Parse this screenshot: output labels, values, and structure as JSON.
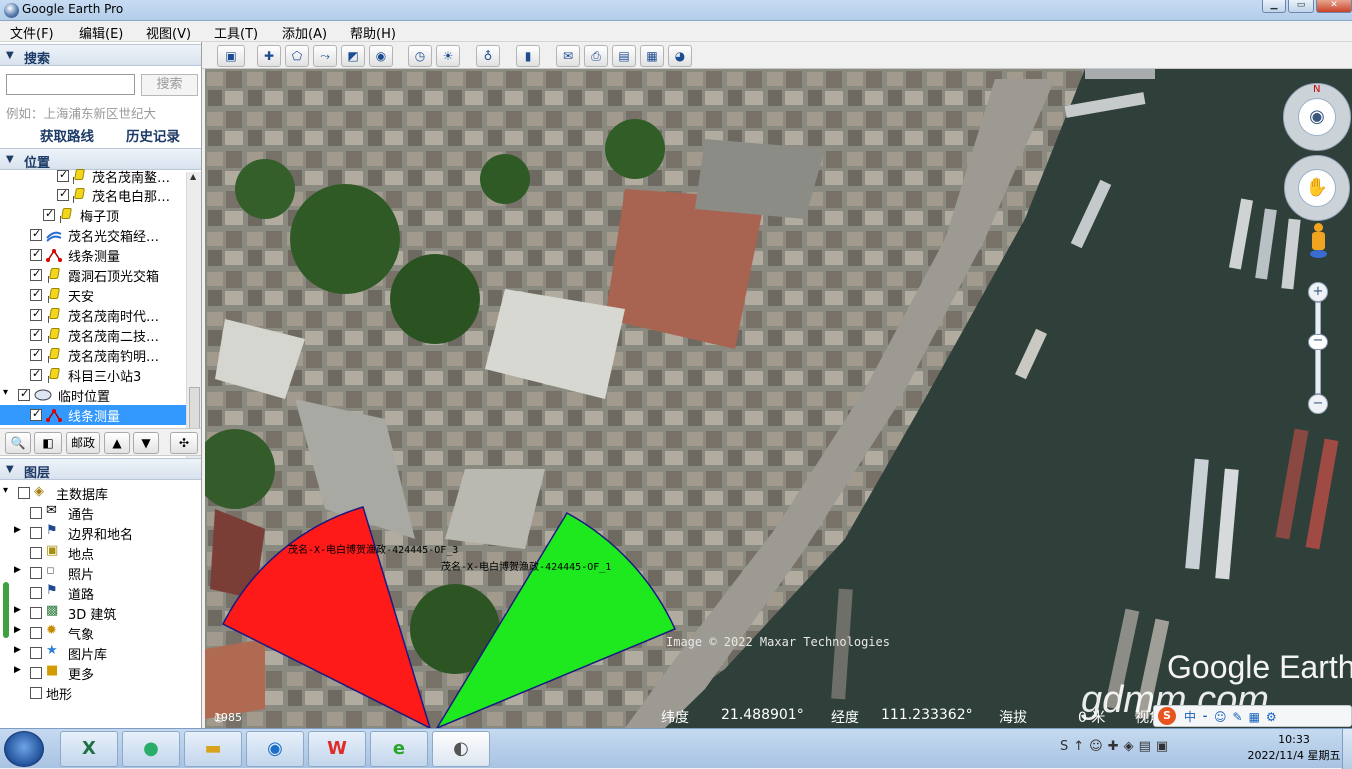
{
  "window": {
    "title": "Google Earth Pro"
  },
  "menu": [
    "文件(F)",
    "编辑(E)",
    "视图(V)",
    "工具(T)",
    "添加(A)",
    "帮助(H)"
  ],
  "search": {
    "header": "搜索",
    "button": "搜索",
    "hint": "例如：上海浦东新区世纪大",
    "get_route": "获取路线",
    "history": "历史记录"
  },
  "places": {
    "header": "位置",
    "items": [
      {
        "label": "茂名茂南鳌…",
        "checked": true,
        "icon": "placemark-icon"
      },
      {
        "label": "茂名电白那…",
        "checked": true,
        "icon": "placemark-icon"
      },
      {
        "label": "梅子顶",
        "checked": true,
        "icon": "placemark-icon"
      },
      {
        "label": "茂名光交箱经…",
        "checked": true,
        "icon": "path-icon"
      },
      {
        "label": "线条测量",
        "checked": true,
        "icon": "measure-icon"
      },
      {
        "label": "霞洞石顶光交箱",
        "checked": true,
        "icon": "placemark-icon"
      },
      {
        "label": "天安",
        "checked": true,
        "icon": "placemark-icon"
      },
      {
        "label": "茂名茂南时代…",
        "checked": true,
        "icon": "placemark-icon"
      },
      {
        "label": "茂名茂南二技…",
        "checked": true,
        "icon": "placemark-icon"
      },
      {
        "label": "茂名茂南钓明…",
        "checked": true,
        "icon": "placemark-icon"
      },
      {
        "label": "科目三小站3",
        "checked": true,
        "icon": "placemark-icon"
      }
    ],
    "temp_folder": "临时位置",
    "temp_item": "线条测量",
    "toolbar_text": "邮政"
  },
  "layers": {
    "header": "图层",
    "items": [
      {
        "label": "主数据库",
        "icon": "database-icon"
      },
      {
        "label": "通告",
        "icon": "mail-icon"
      },
      {
        "label": "边界和地名",
        "icon": "flag-icon"
      },
      {
        "label": "地点",
        "icon": "place-icon"
      },
      {
        "label": "照片",
        "icon": "photo-icon"
      },
      {
        "label": "道路",
        "icon": "road-icon"
      },
      {
        "label": "3D 建筑",
        "icon": "building-icon"
      },
      {
        "label": "气象",
        "icon": "weather-icon"
      },
      {
        "label": "图片库",
        "icon": "gallery-icon"
      },
      {
        "label": "更多",
        "icon": "more-icon"
      },
      {
        "label": "地形",
        "icon": "terrain-icon"
      }
    ]
  },
  "map": {
    "label_red": "茂名-X-电白博贺渔政-424445-OF_3",
    "label_green": "茂名-X-电白博贺渔政-424445-OF_1",
    "imagery_credit": "Image © 2022 Maxar Technologies",
    "brand": "Google Earth",
    "site_watermark": "gdmm.com",
    "historical_year": "1985",
    "lat_label": "纬度",
    "lat_value": "21.488901°",
    "lon_label": "经度",
    "lon_value": "111.233362°",
    "alt_label": "海拔",
    "alt_value": "0 米",
    "view_label": "视角",
    "colors": {
      "red_sector": "#ff1a1a",
      "green_sector": "#1ee81e"
    }
  },
  "taskbar": {
    "apps": [
      "excel-icon",
      "wechat-icon",
      "explorer-icon",
      "browser-icon",
      "wps-icon",
      "ie-icon",
      "google-earth-pro-icon"
    ],
    "time": "10:33",
    "date": "2022/11/4 星期五"
  }
}
